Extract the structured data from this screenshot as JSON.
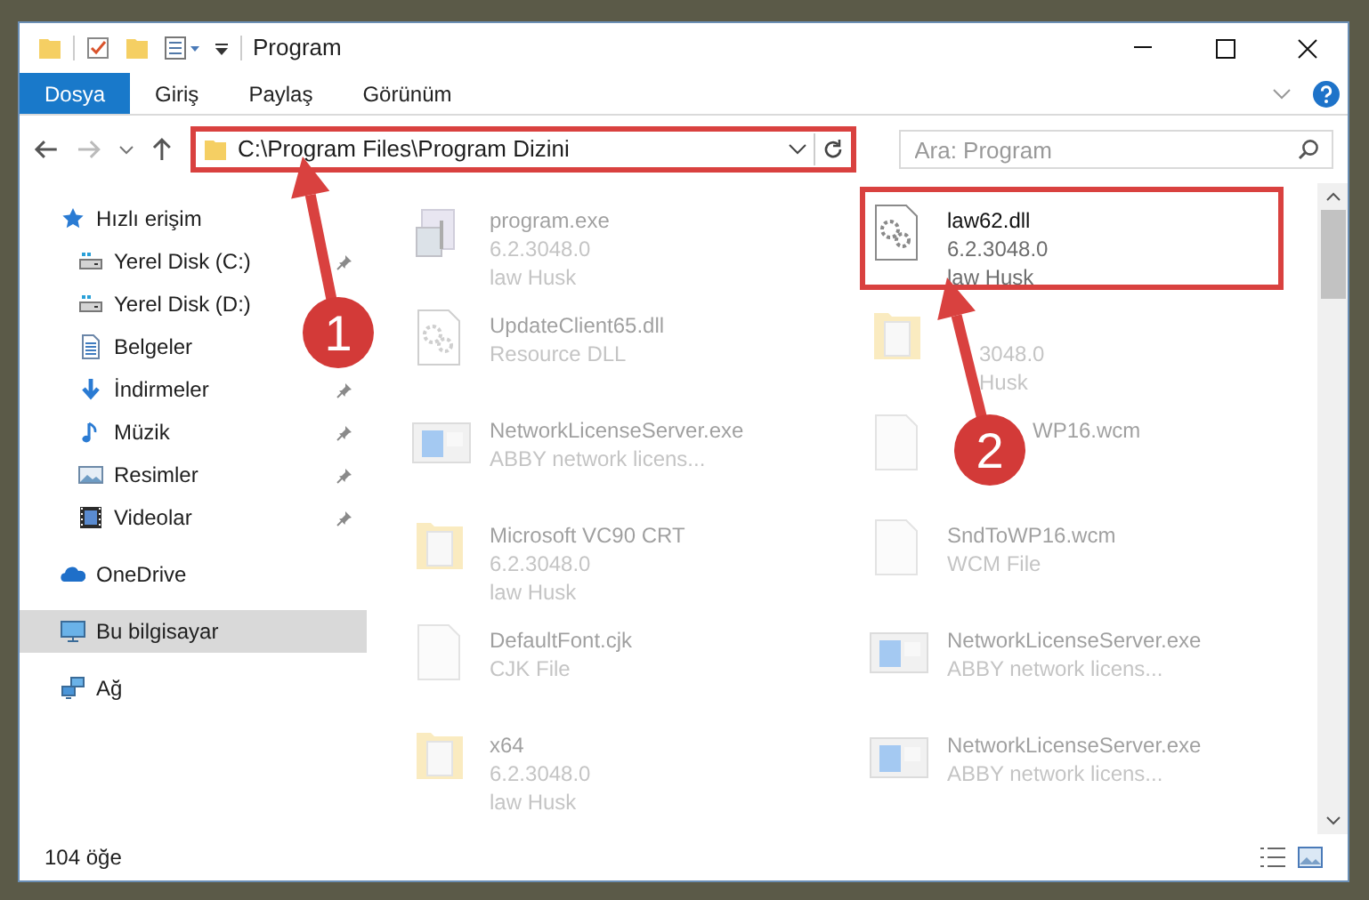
{
  "window": {
    "title": "Program"
  },
  "ribbon_tabs": [
    {
      "label": "Dosya",
      "selected": true
    },
    {
      "label": "Giriş",
      "selected": false
    },
    {
      "label": "Paylaş",
      "selected": false
    },
    {
      "label": "Görünüm",
      "selected": false
    }
  ],
  "address": {
    "path": "C:\\Program Files\\Program Dizini",
    "highlighted": true
  },
  "search": {
    "placeholder": "Ara: Program"
  },
  "sidebar": {
    "items": [
      {
        "label": "Hızlı erişim",
        "kind": "star",
        "selected": false,
        "children": [
          {
            "label": "Yerel Disk (C:)",
            "kind": "drive",
            "pinned": true,
            "selected": false
          },
          {
            "label": "Yerel Disk (D:)",
            "kind": "drive",
            "pinned": false,
            "selected": false
          },
          {
            "label": "Belgeler",
            "kind": "document",
            "pinned": false,
            "selected": false
          },
          {
            "label": "İndirmeler",
            "kind": "download",
            "pinned": true,
            "selected": false
          },
          {
            "label": "Müzik",
            "kind": "music",
            "pinned": true,
            "selected": false
          },
          {
            "label": "Resimler",
            "kind": "picture",
            "pinned": true,
            "selected": false
          },
          {
            "label": "Videolar",
            "kind": "video",
            "pinned": true,
            "selected": false
          }
        ]
      },
      {
        "label": "OneDrive",
        "kind": "cloud",
        "selected": false
      },
      {
        "label": "Bu bilgisayar",
        "kind": "computer",
        "selected": true
      },
      {
        "label": "Ağ",
        "kind": "network",
        "selected": false
      }
    ]
  },
  "files": [
    {
      "name": "program.exe",
      "details": [
        "6.2.3048.0",
        "law Husk"
      ],
      "kind": "installer",
      "blurred": true,
      "highlighted": false
    },
    {
      "name": "law62.dll",
      "details": [
        "6.2.3048.0",
        "law Husk"
      ],
      "kind": "dll",
      "blurred": false,
      "highlighted": true
    },
    {
      "name": "UpdateClient65.dll",
      "details": [
        "Resource DLL"
      ],
      "kind": "dll",
      "blurred": true,
      "highlighted": false
    },
    {
      "details": [
        "3048.0",
        "Husk"
      ],
      "kind": "folder",
      "blurred": true,
      "highlighted": false
    },
    {
      "name": "NetworkLicenseServer.exe",
      "details": [
        "ABBY network licens..."
      ],
      "kind": "app",
      "blurred": true,
      "highlighted": false
    },
    {
      "name": "WP16.wcm",
      "kind": "file",
      "blurred": true,
      "highlighted": false
    },
    {
      "name": "Microsoft VC90 CRT",
      "details": [
        "6.2.3048.0",
        "law Husk"
      ],
      "kind": "folder",
      "blurred": true,
      "highlighted": false
    },
    {
      "name": "SndToWP16.wcm",
      "details": [
        "WCM File"
      ],
      "kind": "file",
      "blurred": true,
      "highlighted": false
    },
    {
      "name": "DefaultFont.cjk",
      "details": [
        "CJK File"
      ],
      "kind": "file",
      "blurred": true,
      "highlighted": false
    },
    {
      "name": "NetworkLicenseServer.exe",
      "details": [
        "ABBY network licens..."
      ],
      "kind": "app",
      "blurred": true,
      "highlighted": false
    },
    {
      "name": "x64",
      "details": [
        "6.2.3048.0",
        "law Husk"
      ],
      "kind": "folder",
      "blurred": true,
      "highlighted": false
    },
    {
      "name": "NetworkLicenseServer.exe",
      "details": [
        "ABBY network licens..."
      ],
      "kind": "app",
      "blurred": true,
      "highlighted": false
    }
  ],
  "status_bar": {
    "count": "104 öğe"
  },
  "callouts": [
    {
      "label": "1"
    },
    {
      "label": "2"
    }
  ]
}
